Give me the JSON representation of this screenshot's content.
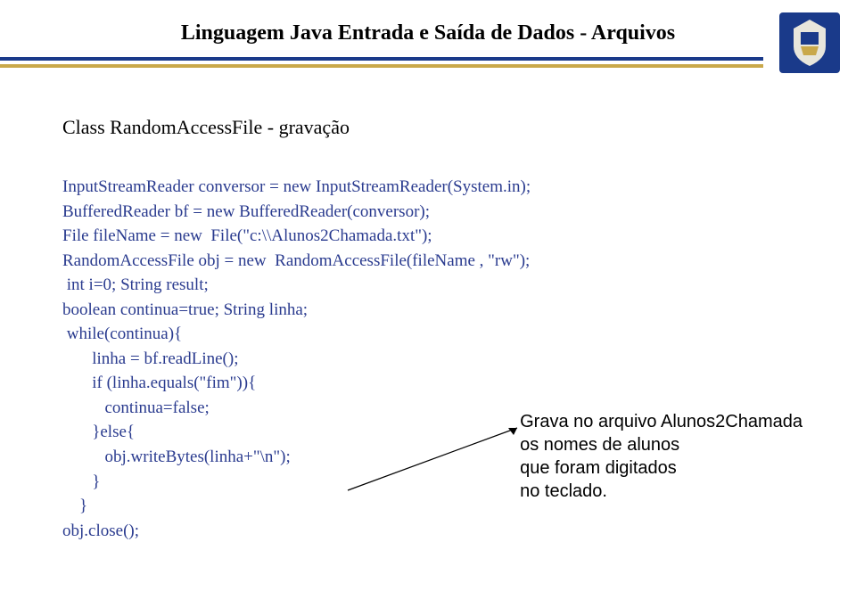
{
  "header": {
    "title": "Linguagem Java Entrada e Saída de Dados - Arquivos"
  },
  "subtitle": "Class RandomAccessFile - gravação",
  "code": {
    "l1": "InputStreamReader conversor = new InputStreamReader(System.in);",
    "l2": "BufferedReader bf = new BufferedReader(conversor);",
    "l3": "File fileName = new  File(\"c:\\\\Alunos2Chamada.txt\");",
    "l4": "RandomAccessFile obj = new  RandomAccessFile(fileName , \"rw\");",
    "l5": " int i=0; String result;",
    "l6": "boolean continua=true; String linha;",
    "l7": " while(continua){",
    "l8": "       linha = bf.readLine();",
    "l9": "       if (linha.equals(\"fim\")){",
    "l10": "          continua=false;",
    "l11": "       }else{",
    "l12": "          obj.writeBytes(linha+\"\\n\");",
    "l13": "       }",
    "l14": "    }",
    "l15": "obj.close();"
  },
  "annotation": {
    "l1": "Grava no arquivo Alunos2Chamada",
    "l2": "os nomes de alunos",
    "l3": "que foram digitados",
    "l4": "no teclado."
  }
}
